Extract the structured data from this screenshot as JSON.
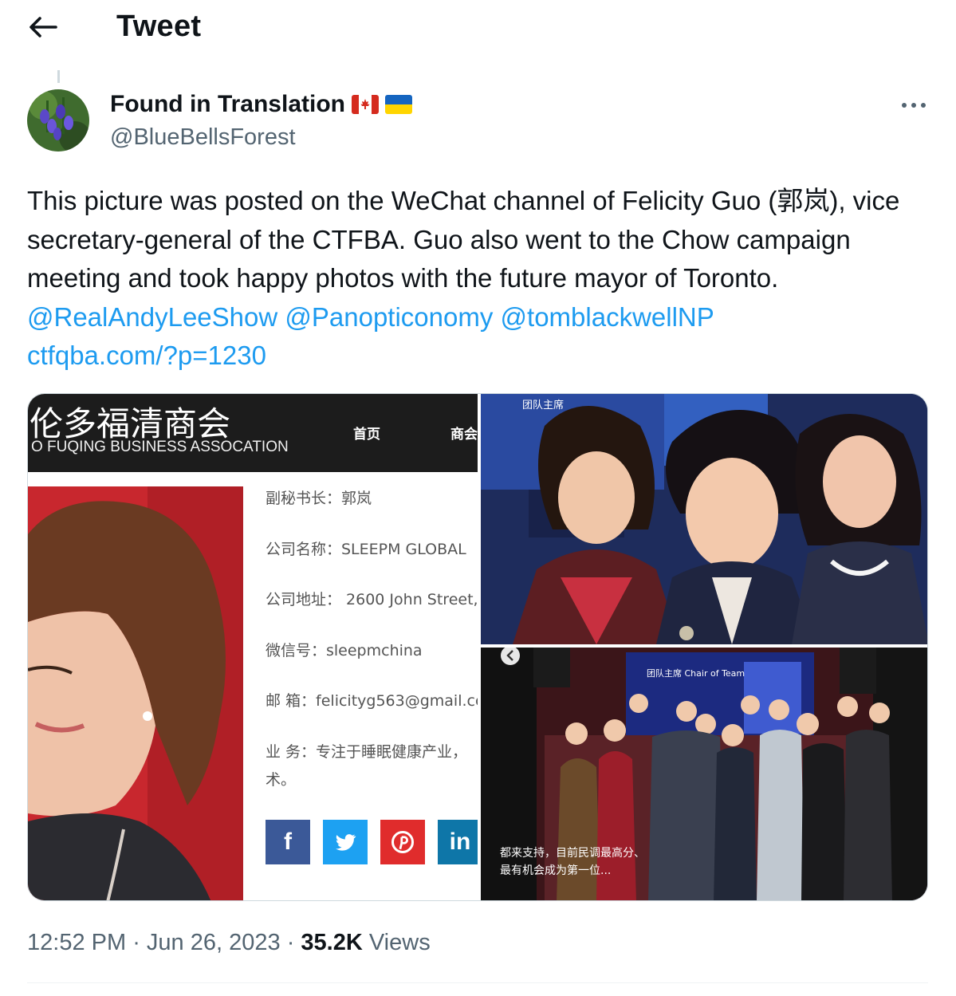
{
  "header": {
    "title": "Tweet"
  },
  "tweet": {
    "display_name": "Found in Translation",
    "flags": [
      "canada-flag",
      "ukraine-flag"
    ],
    "handle": "@BlueBellsForest",
    "text": "This picture was posted on the WeChat channel of Felicity Guo (郭岚), vice secretary-general of the CTFBA. Guo also went to the Chow campaign meeting and took happy photos with the future mayor of Toronto.",
    "mentions": [
      "@RealAndyLeeShow",
      "@Panopticonomy",
      "@tomblackwellNP"
    ],
    "link": "ctfqba.com/?p=1230",
    "time": "12:52 PM",
    "date": "Jun 26, 2023",
    "views_count": "35.2K",
    "views_label": "Views"
  },
  "media": {
    "site": {
      "title_cn": "伦多福清商会",
      "title_en": "O FUQING BUSINESS ASSOCATION",
      "nav": [
        "首页",
        "商会"
      ],
      "fields": [
        "副秘书长：郭岚",
        "公司名称：SLEEPM GLOBAL",
        "公司地址： 2600 John Street,",
        "微信号：sleepmchina",
        "邮 箱：felicityg563@gmail.cc",
        "业 务：专注于睡眠健康产业，",
        "术。"
      ],
      "share_buttons": [
        "f",
        "t",
        "p",
        "in"
      ]
    },
    "photo_top": {
      "sign_text": "团队主席"
    },
    "photo_bottom": {
      "screen_text": "团队主席 Chair of Team",
      "caption_lines": [
        "都来支持，目前民调最高分、",
        "最有机会成为第一位..."
      ]
    }
  },
  "colors": {
    "link": "#1d9bf0",
    "secondary_text": "#536471",
    "facebook": "#3b5998",
    "twitter": "#1da1f2",
    "pinterest": "#e02c2c",
    "linkedin": "#0e76a8"
  }
}
